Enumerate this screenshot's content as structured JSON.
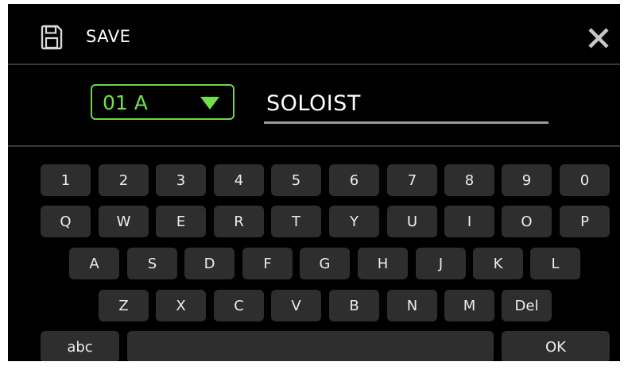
{
  "header": {
    "title": "SAVE",
    "save_icon": "floppy-disk-icon",
    "close_icon": "close-icon"
  },
  "preset": {
    "value": "01 A",
    "arrow_icon": "triangle-down-icon"
  },
  "name_field": {
    "value": "SOLOIST"
  },
  "keyboard": {
    "row1": [
      "1",
      "2",
      "3",
      "4",
      "5",
      "6",
      "7",
      "8",
      "9",
      "0"
    ],
    "row2": [
      "Q",
      "W",
      "E",
      "R",
      "T",
      "Y",
      "U",
      "I",
      "O",
      "P"
    ],
    "row3": [
      "A",
      "S",
      "D",
      "F",
      "G",
      "H",
      "J",
      "K",
      "L"
    ],
    "row4": [
      "Z",
      "X",
      "C",
      "V",
      "B",
      "N",
      "M",
      "Del"
    ],
    "row5": {
      "abc": "abc",
      "space": "",
      "ok": "OK"
    }
  },
  "colors": {
    "background": "#000000",
    "accent_green": "#6fe04c",
    "key_fill": "#2e2e2e",
    "text": "#ffffff"
  }
}
